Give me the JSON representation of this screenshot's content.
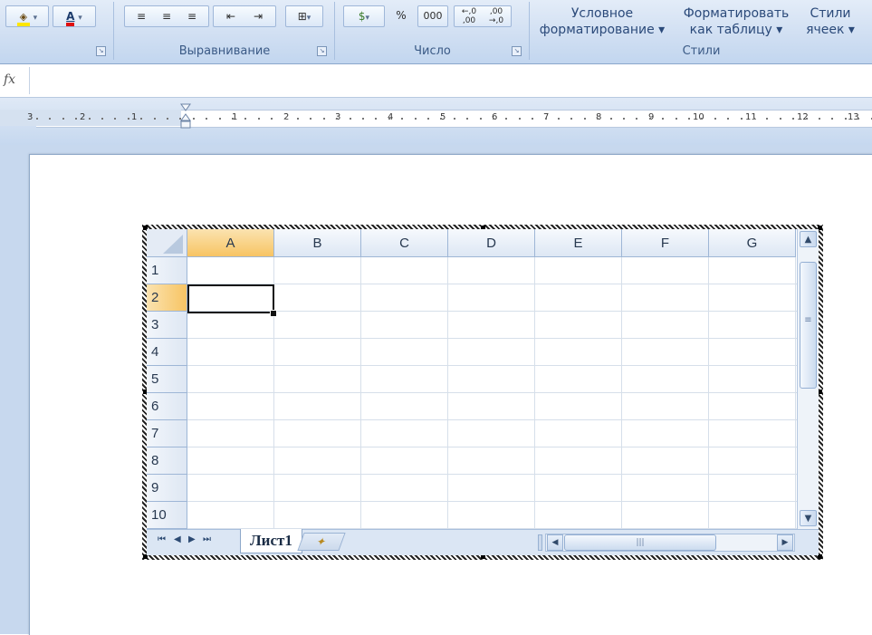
{
  "ribbon": {
    "groups": {
      "alignment_label": "Выравнивание",
      "number_label": "Число",
      "styles_label": "Стили"
    },
    "number": {
      "percent": "%",
      "thousands": "000",
      "inc_decimal_top": "←,0",
      "inc_decimal_bottom": ",00",
      "dec_decimal_top": ",00",
      "dec_decimal_bottom": "→,0"
    },
    "styles": {
      "conditional_line1": "Условное",
      "conditional_line2": "форматирование ▾",
      "format_table_line1": "Форматировать",
      "format_table_line2": "как таблицу ▾",
      "cell_styles_line1": "Стили",
      "cell_styles_line2": "ячеек ▾"
    },
    "font_color_letter": "A"
  },
  "formula_bar": {
    "fx_label": "fx"
  },
  "ruler": {
    "numbers": [
      "3",
      "2",
      "1",
      "1",
      "2",
      "3",
      "4",
      "5",
      "6",
      "7",
      "8",
      "9",
      "10",
      "11",
      "12",
      "13"
    ]
  },
  "sheet": {
    "columns": [
      "A",
      "B",
      "C",
      "D",
      "E",
      "F",
      "G"
    ],
    "rows": [
      "1",
      "2",
      "3",
      "4",
      "5",
      "6",
      "7",
      "8",
      "9",
      "10"
    ],
    "selected_column": "A",
    "selected_row": "2",
    "active_tab": "Лист1"
  },
  "colors": {
    "ribbon_bg": "#cfdef2",
    "header_selected": "#f7c463",
    "grid_line": "#d6dfea",
    "page_bg": "#c7d8ee"
  }
}
